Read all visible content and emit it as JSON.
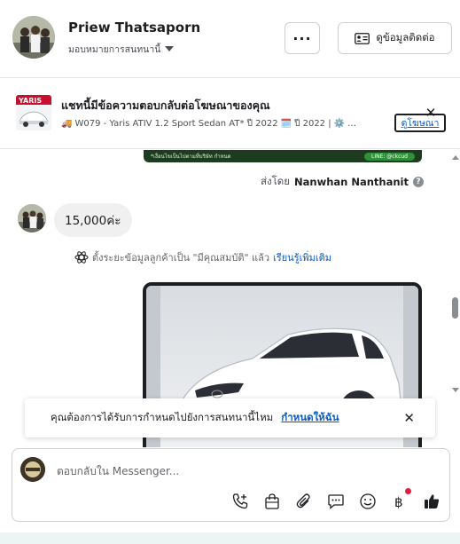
{
  "header": {
    "contact_name": "Priew Thatsaporn",
    "assign_label": "มอบหมายการสนทนานี้",
    "more_label": "···",
    "contact_info_label": "ดูข้อมูลติดต่อ"
  },
  "ad_banner": {
    "thumb_text": "YARIS",
    "title": "แชทนี้มีข้อความตอบกลับต่อโฆษณาของคุณ",
    "subtitle_truck": "🚚",
    "subtitle_part1": "W079 - Yaris ATIV 1.2 Sport Sedan AT* ปี 2022",
    "subtitle_cal": "🗓️",
    "subtitle_part2": "ปี 2022 |",
    "subtitle_gear": "⚙️",
    "subtitle_ellipsis": "…",
    "view_ad_label": "ดูโฆษณา"
  },
  "chat": {
    "strip_text": "*เงื่อนไขเป็นไปตามที่บริษัท กำหนด",
    "strip_line": "LINE: @ckcud",
    "sent_by_prefix": "ส่งโดย",
    "sent_by_name": "Nanwhan Nanthanit",
    "bubble_text": "15,000ค่ะ",
    "system_note": "ตั้งระยะข้อมูลลูกค้าเป็น \"มีคุณสมบัติ\" แล้ว",
    "system_link": "เรียนรู้เพิ่มเติม"
  },
  "reminder": {
    "text": "คุณต้องการได้รับการกำหนดไปยังการสนทนานี้ไหม",
    "link": "กำหนดให้ฉัน"
  },
  "composer": {
    "placeholder": "ตอบกลับใน Messenger..."
  },
  "colors": {
    "link": "#0a5dc2",
    "notification_dot": "#e41e3f",
    "like": "#1c1e21"
  }
}
